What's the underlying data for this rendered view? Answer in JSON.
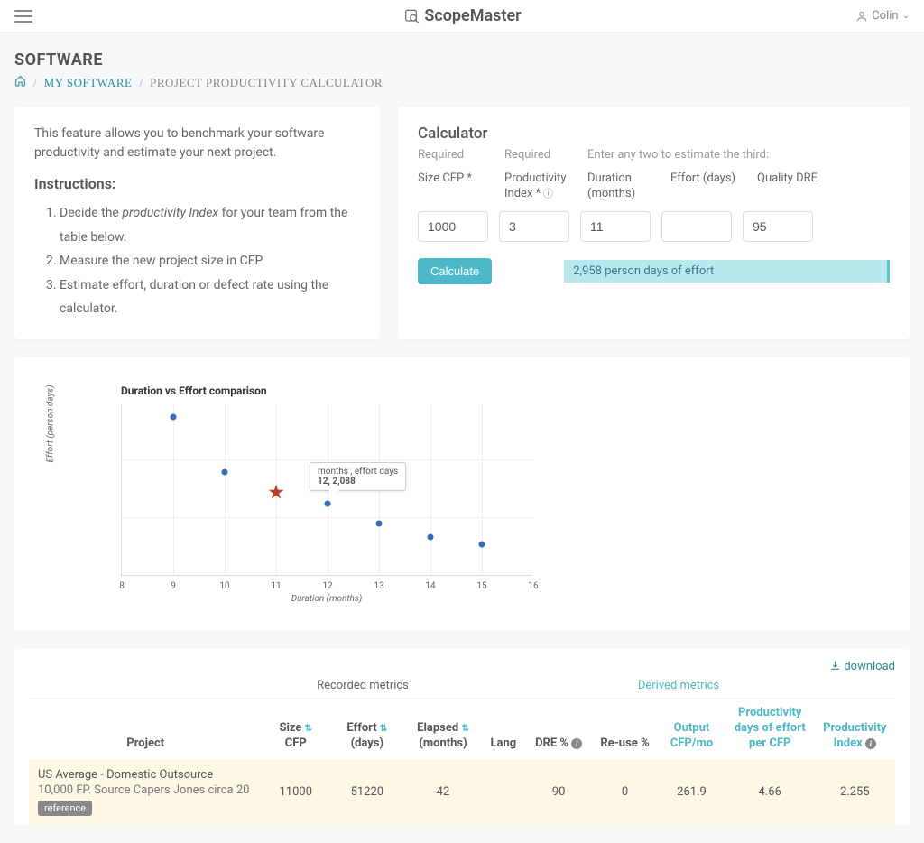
{
  "header": {
    "logo_text": "ScopeMaster",
    "user_name": "Colin"
  },
  "page": {
    "title": "SOFTWARE",
    "breadcrumb": {
      "home": "⌂",
      "item1": "MY SOFTWARE",
      "current": "PROJECT PRODUCTIVITY CALCULATOR"
    }
  },
  "intro": {
    "text": "This feature allows you to benchmark your software productivity and estimate your next project.",
    "instructions_title": "Instructions:",
    "steps": [
      "Decide the productivity Index for your team from the table below.",
      "Measure the new project size in CFP",
      "Estimate effort, duration or defect rate using the calculator."
    ]
  },
  "calculator": {
    "title": "Calculator",
    "required": "Required",
    "hint": "Enter any two to estimate the third:",
    "labels": {
      "size": "Size CFP *",
      "productivity": "Productivity Index *",
      "duration": "Duration (months)",
      "effort": "Effort (days)",
      "quality": "Quality DRE"
    },
    "values": {
      "size": "1000",
      "productivity": "3",
      "duration": "11",
      "effort": "",
      "quality": "95"
    },
    "button": "Calculate",
    "result": "2,958 person days of effort"
  },
  "chart_data": {
    "type": "scatter",
    "title": "Duration vs Effort comparison",
    "xlabel": "Duration (months)",
    "ylabel": "Effort (person days)",
    "xlim": [
      8,
      16
    ],
    "x_ticks": [
      8,
      9,
      10,
      11,
      12,
      13,
      14,
      15,
      16
    ],
    "series": [
      {
        "name": "scenarios",
        "marker": "dot",
        "color": "#3b6db5",
        "points": [
          {
            "x": 9,
            "y": 4600
          },
          {
            "x": 10,
            "y": 3000
          },
          {
            "x": 12,
            "y": 2088
          },
          {
            "x": 13,
            "y": 1500
          },
          {
            "x": 14,
            "y": 1100
          },
          {
            "x": 15,
            "y": 900
          }
        ]
      },
      {
        "name": "selected",
        "marker": "star",
        "color": "#b5432a",
        "points": [
          {
            "x": 11,
            "y": 2400
          }
        ]
      }
    ],
    "tooltip": {
      "header": "months , effort days",
      "value": "12, 2,088",
      "at_x": 12
    }
  },
  "table": {
    "download": "download",
    "group_recorded": "Recorded metrics",
    "group_derived": "Derived metrics",
    "headers": {
      "project": "Project",
      "size": "Size",
      "size_unit": "CFP",
      "effort": "Effort",
      "effort_unit": "(days)",
      "elapsed": "Elapsed",
      "elapsed_unit": "(months)",
      "lang": "Lang",
      "dre": "DRE %",
      "reuse": "Re-use %",
      "output": "Output",
      "output_unit": "CFP/mo",
      "prod_days": "Productivity days of effort per CFP",
      "prod_index": "Productivity Index"
    },
    "rows": [
      {
        "project": "US Average - Domestic Outsource",
        "project_sub": "10,000 FP. Source Capers Jones circa 20",
        "badge": "reference",
        "size": "11000",
        "effort": "51220",
        "elapsed": "42",
        "lang": "",
        "dre": "90",
        "reuse": "0",
        "output": "261.9",
        "prod_days": "4.66",
        "prod_index": "2.255"
      }
    ]
  }
}
